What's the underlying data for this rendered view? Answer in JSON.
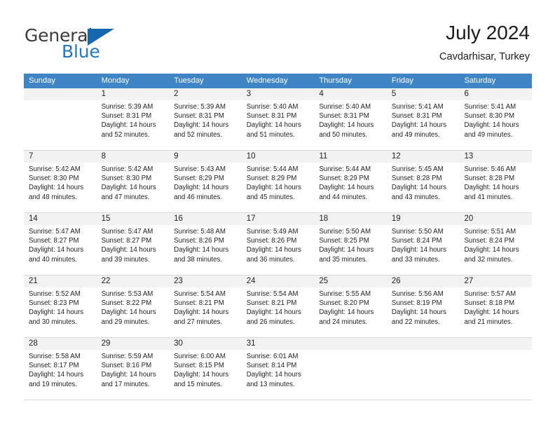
{
  "brand": {
    "name_top": "General",
    "name_bottom": "Blue",
    "accent_color": "#2079c4",
    "triangle_color": "#1667b0"
  },
  "header": {
    "title": "July 2024",
    "subtitle": "Cavdarhisar, Turkey"
  },
  "calendar": {
    "header_bg": "#3f84c4",
    "daynum_bg": "#f2f2f2",
    "weekdays": [
      "Sunday",
      "Monday",
      "Tuesday",
      "Wednesday",
      "Thursday",
      "Friday",
      "Saturday"
    ],
    "weeks": [
      [
        {
          "day": "",
          "lines": []
        },
        {
          "day": "1",
          "lines": [
            "Sunrise: 5:39 AM",
            "Sunset: 8:31 PM",
            "Daylight: 14 hours",
            "and 52 minutes."
          ]
        },
        {
          "day": "2",
          "lines": [
            "Sunrise: 5:39 AM",
            "Sunset: 8:31 PM",
            "Daylight: 14 hours",
            "and 52 minutes."
          ]
        },
        {
          "day": "3",
          "lines": [
            "Sunrise: 5:40 AM",
            "Sunset: 8:31 PM",
            "Daylight: 14 hours",
            "and 51 minutes."
          ]
        },
        {
          "day": "4",
          "lines": [
            "Sunrise: 5:40 AM",
            "Sunset: 8:31 PM",
            "Daylight: 14 hours",
            "and 50 minutes."
          ]
        },
        {
          "day": "5",
          "lines": [
            "Sunrise: 5:41 AM",
            "Sunset: 8:31 PM",
            "Daylight: 14 hours",
            "and 49 minutes."
          ]
        },
        {
          "day": "6",
          "lines": [
            "Sunrise: 5:41 AM",
            "Sunset: 8:30 PM",
            "Daylight: 14 hours",
            "and 49 minutes."
          ]
        }
      ],
      [
        {
          "day": "7",
          "lines": [
            "Sunrise: 5:42 AM",
            "Sunset: 8:30 PM",
            "Daylight: 14 hours",
            "and 48 minutes."
          ]
        },
        {
          "day": "8",
          "lines": [
            "Sunrise: 5:42 AM",
            "Sunset: 8:30 PM",
            "Daylight: 14 hours",
            "and 47 minutes."
          ]
        },
        {
          "day": "9",
          "lines": [
            "Sunrise: 5:43 AM",
            "Sunset: 8:29 PM",
            "Daylight: 14 hours",
            "and 46 minutes."
          ]
        },
        {
          "day": "10",
          "lines": [
            "Sunrise: 5:44 AM",
            "Sunset: 8:29 PM",
            "Daylight: 14 hours",
            "and 45 minutes."
          ]
        },
        {
          "day": "11",
          "lines": [
            "Sunrise: 5:44 AM",
            "Sunset: 8:29 PM",
            "Daylight: 14 hours",
            "and 44 minutes."
          ]
        },
        {
          "day": "12",
          "lines": [
            "Sunrise: 5:45 AM",
            "Sunset: 8:28 PM",
            "Daylight: 14 hours",
            "and 43 minutes."
          ]
        },
        {
          "day": "13",
          "lines": [
            "Sunrise: 5:46 AM",
            "Sunset: 8:28 PM",
            "Daylight: 14 hours",
            "and 41 minutes."
          ]
        }
      ],
      [
        {
          "day": "14",
          "lines": [
            "Sunrise: 5:47 AM",
            "Sunset: 8:27 PM",
            "Daylight: 14 hours",
            "and 40 minutes."
          ]
        },
        {
          "day": "15",
          "lines": [
            "Sunrise: 5:47 AM",
            "Sunset: 8:27 PM",
            "Daylight: 14 hours",
            "and 39 minutes."
          ]
        },
        {
          "day": "16",
          "lines": [
            "Sunrise: 5:48 AM",
            "Sunset: 8:26 PM",
            "Daylight: 14 hours",
            "and 38 minutes."
          ]
        },
        {
          "day": "17",
          "lines": [
            "Sunrise: 5:49 AM",
            "Sunset: 8:26 PM",
            "Daylight: 14 hours",
            "and 36 minutes."
          ]
        },
        {
          "day": "18",
          "lines": [
            "Sunrise: 5:50 AM",
            "Sunset: 8:25 PM",
            "Daylight: 14 hours",
            "and 35 minutes."
          ]
        },
        {
          "day": "19",
          "lines": [
            "Sunrise: 5:50 AM",
            "Sunset: 8:24 PM",
            "Daylight: 14 hours",
            "and 33 minutes."
          ]
        },
        {
          "day": "20",
          "lines": [
            "Sunrise: 5:51 AM",
            "Sunset: 8:24 PM",
            "Daylight: 14 hours",
            "and 32 minutes."
          ]
        }
      ],
      [
        {
          "day": "21",
          "lines": [
            "Sunrise: 5:52 AM",
            "Sunset: 8:23 PM",
            "Daylight: 14 hours",
            "and 30 minutes."
          ]
        },
        {
          "day": "22",
          "lines": [
            "Sunrise: 5:53 AM",
            "Sunset: 8:22 PM",
            "Daylight: 14 hours",
            "and 29 minutes."
          ]
        },
        {
          "day": "23",
          "lines": [
            "Sunrise: 5:54 AM",
            "Sunset: 8:21 PM",
            "Daylight: 14 hours",
            "and 27 minutes."
          ]
        },
        {
          "day": "24",
          "lines": [
            "Sunrise: 5:54 AM",
            "Sunset: 8:21 PM",
            "Daylight: 14 hours",
            "and 26 minutes."
          ]
        },
        {
          "day": "25",
          "lines": [
            "Sunrise: 5:55 AM",
            "Sunset: 8:20 PM",
            "Daylight: 14 hours",
            "and 24 minutes."
          ]
        },
        {
          "day": "26",
          "lines": [
            "Sunrise: 5:56 AM",
            "Sunset: 8:19 PM",
            "Daylight: 14 hours",
            "and 22 minutes."
          ]
        },
        {
          "day": "27",
          "lines": [
            "Sunrise: 5:57 AM",
            "Sunset: 8:18 PM",
            "Daylight: 14 hours",
            "and 21 minutes."
          ]
        }
      ],
      [
        {
          "day": "28",
          "lines": [
            "Sunrise: 5:58 AM",
            "Sunset: 8:17 PM",
            "Daylight: 14 hours",
            "and 19 minutes."
          ]
        },
        {
          "day": "29",
          "lines": [
            "Sunrise: 5:59 AM",
            "Sunset: 8:16 PM",
            "Daylight: 14 hours",
            "and 17 minutes."
          ]
        },
        {
          "day": "30",
          "lines": [
            "Sunrise: 6:00 AM",
            "Sunset: 8:15 PM",
            "Daylight: 14 hours",
            "and 15 minutes."
          ]
        },
        {
          "day": "31",
          "lines": [
            "Sunrise: 6:01 AM",
            "Sunset: 8:14 PM",
            "Daylight: 14 hours",
            "and 13 minutes."
          ]
        },
        {
          "day": "",
          "lines": []
        },
        {
          "day": "",
          "lines": []
        },
        {
          "day": "",
          "lines": []
        }
      ]
    ]
  }
}
